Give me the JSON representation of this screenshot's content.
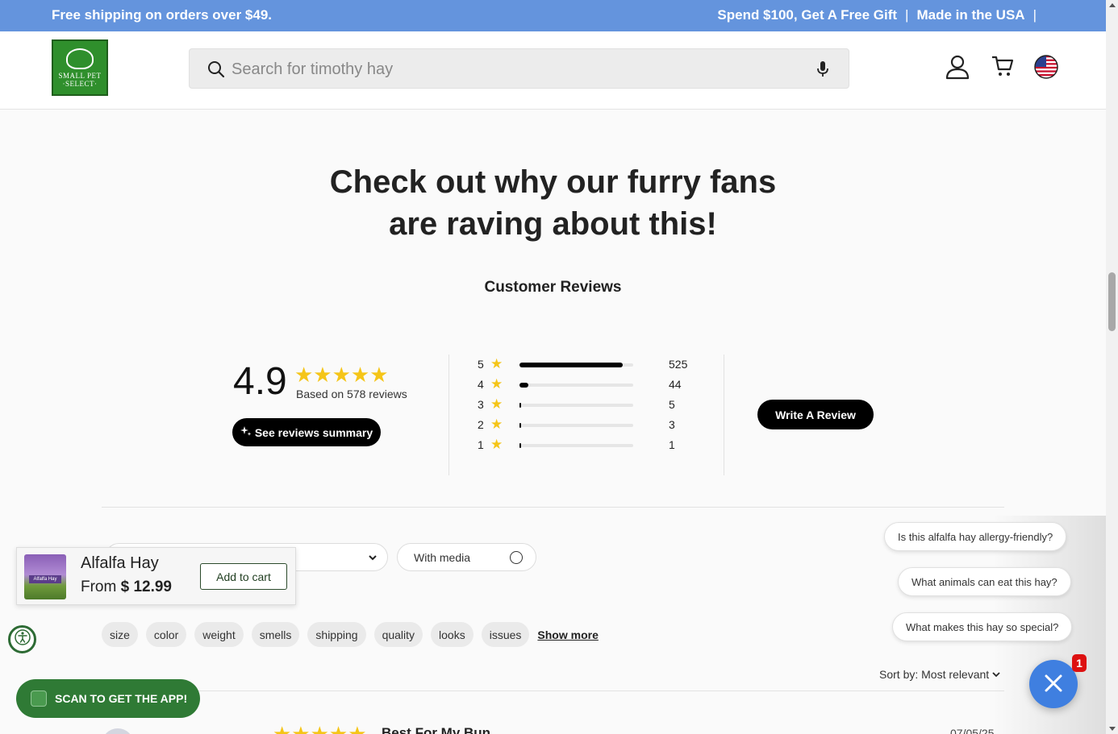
{
  "announcement": {
    "left": "Free shipping on orders over $49.",
    "right_1": "Spend $100, Get A Free Gift",
    "right_2": "Made in the USA",
    "sep": "|"
  },
  "header": {
    "logo_text_1": "SMALL PET",
    "logo_text_2": "·SELECT·",
    "search_placeholder": "Search for timothy hay"
  },
  "section": {
    "headline_1": "Check out why our furry fans",
    "headline_2": "are raving about this!",
    "title": "Customer Reviews"
  },
  "summary": {
    "average": "4.9",
    "stars": "★★★★★",
    "based_on": "Based on 578 reviews",
    "summary_button": "See reviews summary",
    "write_button": "Write A Review"
  },
  "histogram": [
    {
      "stars": "5",
      "count": "525",
      "fraction": 0.908
    },
    {
      "stars": "4",
      "count": "44",
      "fraction": 0.076
    },
    {
      "stars": "3",
      "count": "5",
      "fraction": 0.009
    },
    {
      "stars": "2",
      "count": "3",
      "fraction": 0.005
    },
    {
      "stars": "1",
      "count": "1",
      "fraction": 0.002
    }
  ],
  "filters": {
    "with_media": "With media",
    "chips": [
      "size",
      "color",
      "weight",
      "smells",
      "shipping",
      "quality",
      "looks",
      "issues"
    ],
    "show_more": "Show more",
    "sort_label": "Sort by:",
    "sort_value": "Most relevant"
  },
  "review": {
    "stars": "★★★★★",
    "title": "Best For My Bun",
    "date": "07/05/25"
  },
  "sticky_product": {
    "name": "Alfalfa Hay",
    "price_prefix": "From",
    "price": "$ 12.99",
    "add_to_cart": "Add to cart",
    "thumb_label": "Alfalfa Hay"
  },
  "app_button": "SCAN TO GET THE APP!",
  "chat": {
    "questions": [
      "Is this alfalfa hay allergy-friendly?",
      "What animals can eat this hay?",
      "What makes this hay so special?"
    ],
    "badge": "1"
  },
  "colors": {
    "announcement_bg": "#6494dd",
    "star": "#f5c518",
    "brand_green": "#2f8f2c",
    "chat_blue": "#3f7fe0"
  }
}
